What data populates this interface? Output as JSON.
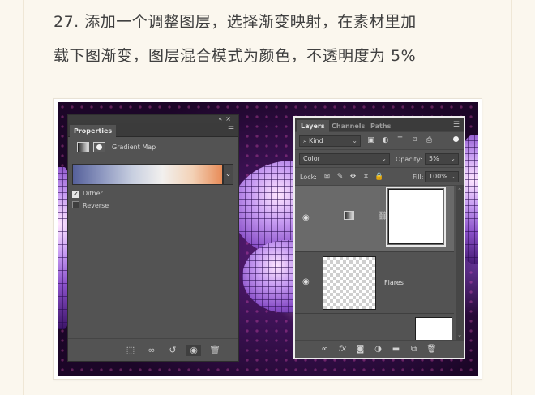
{
  "caption": {
    "line1": "27. 添加一个调整图层，选择渐变映射，在素材里加",
    "line2": "载下图渐变，图层混合模式为颜色，不透明度为 5%"
  },
  "properties_panel": {
    "tab": "Properties",
    "title": "Gradient Map",
    "gradient_colors": [
      "#55609a",
      "#8f99c1",
      "#c8cfe0",
      "#f2f0ee",
      "#f3d2b7",
      "#e88c58"
    ],
    "dither_label": "Dither",
    "dither_checked": true,
    "reverse_label": "Reverse",
    "reverse_checked": false,
    "footer_icons": [
      "clip-to-layer-icon",
      "view-previous-icon",
      "reset-icon",
      "visibility-eye-icon",
      "trash-icon"
    ]
  },
  "layers_panel": {
    "tabs": [
      "Layers",
      "Channels",
      "Paths"
    ],
    "active_tab": "Layers",
    "filter_kind": "Kind",
    "filter_icons": [
      "pixel-filter-icon",
      "adjustment-filter-icon",
      "type-filter-icon",
      "shape-filter-icon",
      "smart-object-filter-icon"
    ],
    "blend_mode": "Color",
    "opacity_label": "Opacity:",
    "opacity_value": "5%",
    "lock_label": "Lock:",
    "fill_label": "Fill:",
    "fill_value": "100%",
    "layers": [
      {
        "name": "",
        "type": "gradient-map-adjustment",
        "selected": true
      },
      {
        "name": "Flares",
        "type": "pixel"
      },
      {
        "name": "",
        "type": "pixel"
      }
    ],
    "footer_icons": [
      "link-icon",
      "fx-icon",
      "add-mask-icon",
      "adjustment-layer-icon",
      "group-folder-icon",
      "new-layer-icon",
      "trash-icon"
    ]
  }
}
